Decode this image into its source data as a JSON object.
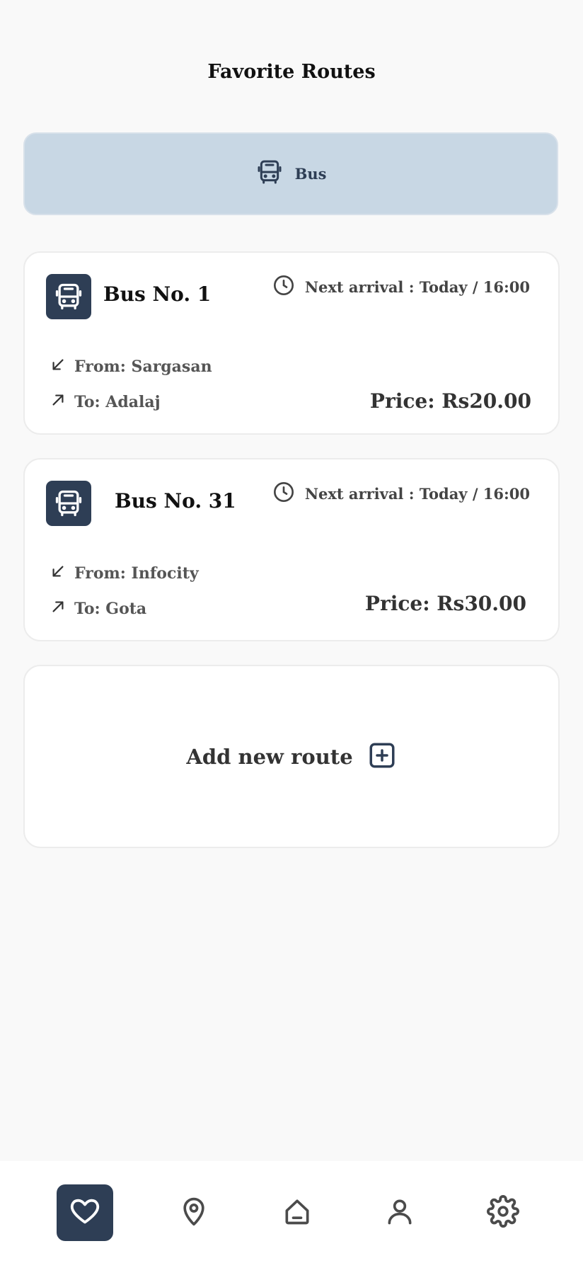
{
  "header": {
    "title": "Favorite Routes"
  },
  "filter": {
    "label": "Bus",
    "icon": "bus-icon"
  },
  "routes": [
    {
      "name": "Bus No. 1",
      "arrival": "Next arrival : Today / 16:00",
      "from": "From: Sargasan",
      "to": "To: Adalaj",
      "price": "Price: Rs20.00"
    },
    {
      "name": "Bus No. 31",
      "arrival": "Next arrival : Today / 16:00",
      "from": "From: Infocity",
      "to": "To: Gota",
      "price": "Price: Rs30.00"
    }
  ],
  "add_route": {
    "label": "Add new route",
    "icon": "plus-square-icon"
  },
  "nav": {
    "items": [
      {
        "icon": "heart-icon",
        "active": true
      },
      {
        "icon": "map-pin-icon",
        "active": false
      },
      {
        "icon": "home-icon",
        "active": false
      },
      {
        "icon": "user-icon",
        "active": false
      },
      {
        "icon": "gear-icon",
        "active": false
      }
    ]
  },
  "colors": {
    "accent": "#2e3e55",
    "filter_bg": "#c8d7e4",
    "background": "#f9f9f9",
    "card": "#ffffff"
  }
}
